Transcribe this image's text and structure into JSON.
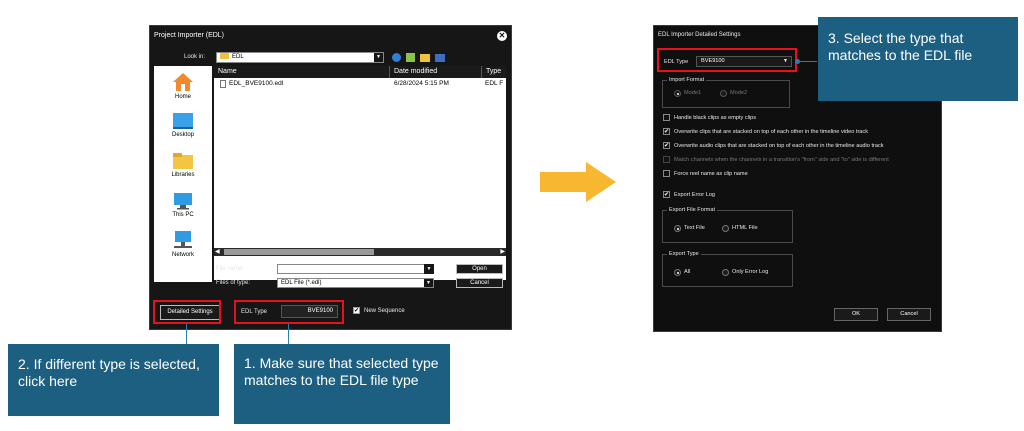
{
  "left_dialog": {
    "title": "Project Importer (EDL)",
    "look_in_label": "Look in:",
    "look_in_value": "EDL",
    "places": [
      {
        "label": "Home",
        "icon": "home-icon"
      },
      {
        "label": "Desktop",
        "icon": "desktop-icon"
      },
      {
        "label": "Libraries",
        "icon": "folder-icon"
      },
      {
        "label": "This PC",
        "icon": "computer-icon"
      },
      {
        "label": "Network",
        "icon": "network-icon"
      }
    ],
    "columns": [
      "Name",
      "Date modified",
      "Type"
    ],
    "files": [
      {
        "name": "EDL_BVE9100.edl",
        "date": "6/28/2024 5:15 PM",
        "type": "EDL F"
      }
    ],
    "file_name_label": "File name:",
    "file_name_value": "",
    "files_of_type_label": "Files of type:",
    "files_of_type_value": "EDL File (*.edl)",
    "open_label": "Open",
    "cancel_label": "Cancel",
    "detailed_settings_label": "Detailed Settings",
    "edl_type_label": "EDL Type",
    "edl_type_value": "BVE9100",
    "new_sequence_label": "New Sequence",
    "new_sequence_checked": true
  },
  "right_dialog": {
    "title": "EDL Importer Detailed Settings",
    "edl_type_label": "EDL Type",
    "edl_type_value": "BVE9100",
    "import_format_label": "Import Format",
    "mode1_label": "Mode1",
    "mode2_label": "Mode2",
    "options": [
      {
        "label": "Handle black clips as empty clips",
        "checked": false,
        "enabled": true
      },
      {
        "label": "Overwrite clips that are stacked on top of each other in the timeline video track",
        "checked": true,
        "enabled": true
      },
      {
        "label": "Overwrite audio clips that are stacked on top of each other in the timeline audio track",
        "checked": true,
        "enabled": true
      },
      {
        "label": "Match channels when the channels in a transition's \"from\" side and \"to\" side is different",
        "checked": false,
        "enabled": false
      },
      {
        "label": "Force reel name as clip name",
        "checked": false,
        "enabled": true
      }
    ],
    "export_error_log_label": "Export Error Log",
    "export_file_format_label": "Export File Format",
    "text_file_label": "Text File",
    "html_file_label": "HTML File",
    "export_type_label": "Export Type",
    "all_label": "All",
    "only_error_log_label": "Only Error Log",
    "ok_label": "OK",
    "cancel_label": "Cancel"
  },
  "callouts": {
    "step1": "1.  Make sure that selected type matches to the EDL file type",
    "step2": "2.  If different type is selected, click here",
    "step3": "3.  Select the type that matches to the EDL file"
  },
  "colors": {
    "callout_bg": "#1d5f80",
    "highlight_red": "#e8101a",
    "arrow_yellow": "#f7b731"
  }
}
